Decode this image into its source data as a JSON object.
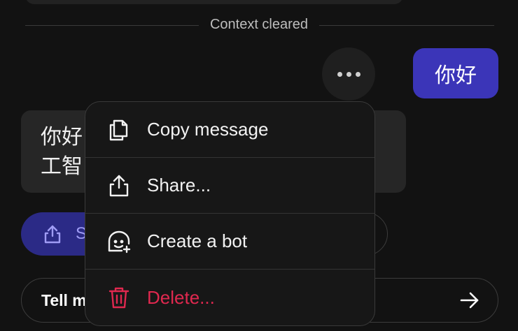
{
  "divider": {
    "label": "Context cleared"
  },
  "user_message": {
    "text": "你好"
  },
  "bot_message": {
    "line1": "你好",
    "line2": "工智"
  },
  "share_pill": {
    "label": "S",
    "icon": "share-icon"
  },
  "composer": {
    "placeholder": "Tell m",
    "send_icon": "arrow-right-icon"
  },
  "menu": {
    "items": [
      {
        "label": "Copy message",
        "icon": "copy-icon"
      },
      {
        "label": "Share...",
        "icon": "share-icon"
      },
      {
        "label": "Create a bot",
        "icon": "bot-add-icon"
      },
      {
        "label": "Delete...",
        "icon": "trash-icon",
        "color": "#e0284f"
      }
    ]
  },
  "colors": {
    "accent": "#3b35b8",
    "danger": "#e0284f",
    "background": "#121212"
  }
}
